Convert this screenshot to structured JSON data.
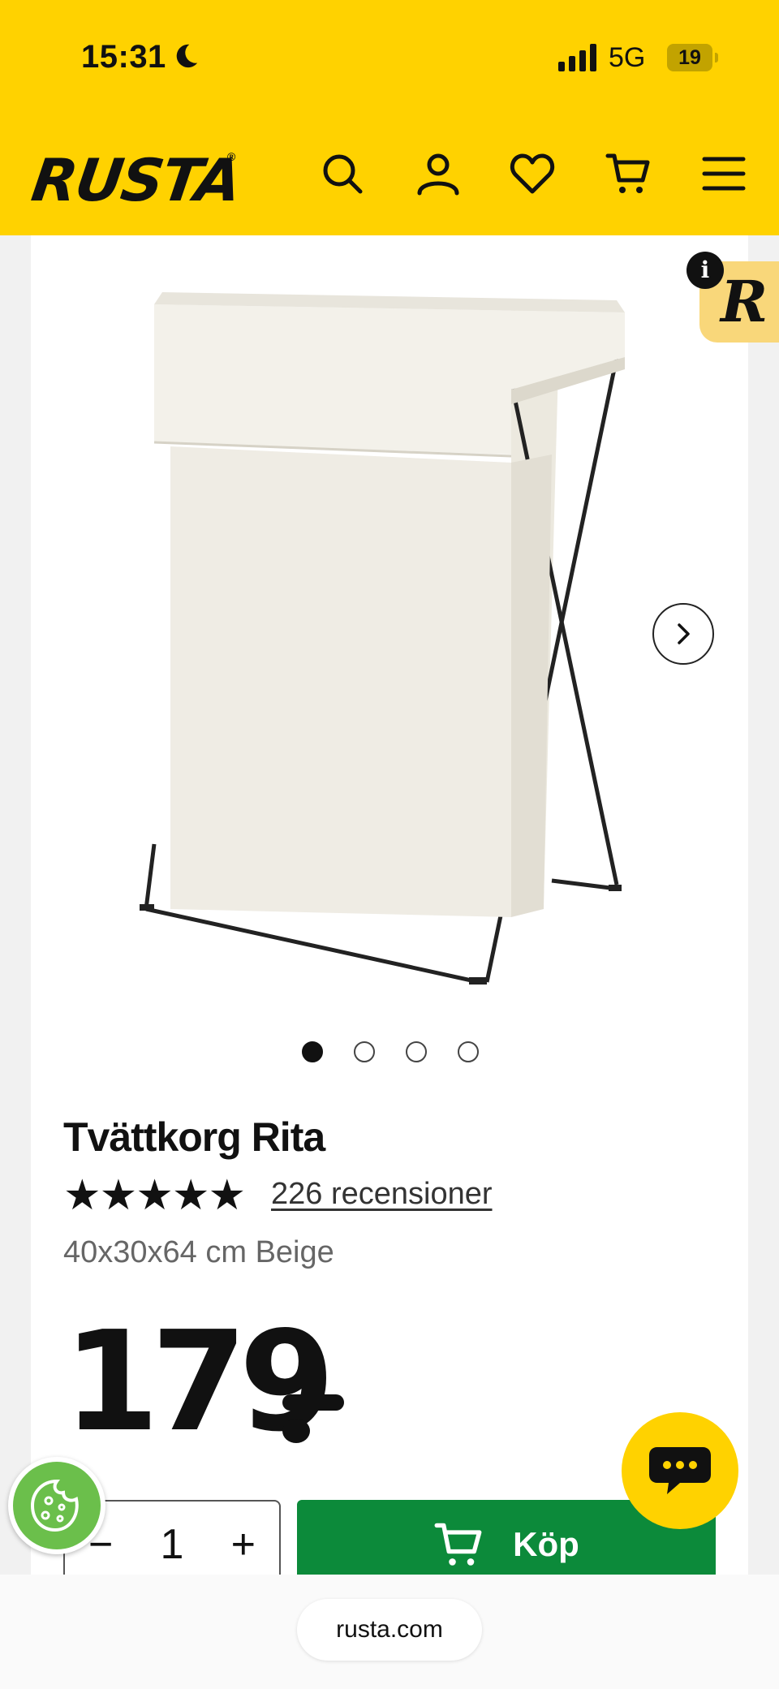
{
  "status_bar": {
    "time": "15:31",
    "network": "5G",
    "battery": "19"
  },
  "header": {
    "logo": "RUSTA",
    "logo_mark": "®",
    "icons": [
      "search-icon",
      "account-icon",
      "heart-icon",
      "cart-icon",
      "menu-icon"
    ]
  },
  "badge": {
    "info": "i",
    "letter": "R"
  },
  "product": {
    "title": "Tvättkorg Rita",
    "rating_stars": "★★★★★",
    "rating": 5,
    "reviews_label": "226 recensioner",
    "variant": "40x30x64 cm Beige",
    "price": "179",
    "image_count": 4,
    "active_image": 1
  },
  "purchase": {
    "qty_minus": "−",
    "qty_value": "1",
    "qty_plus": "+",
    "buy_label": "Köp"
  },
  "browser": {
    "url": "rusta.com"
  },
  "colors": {
    "brand_yellow": "#ffd200",
    "buy_green": "#0c8a3a",
    "cookie_green": "#6bbf4b"
  }
}
